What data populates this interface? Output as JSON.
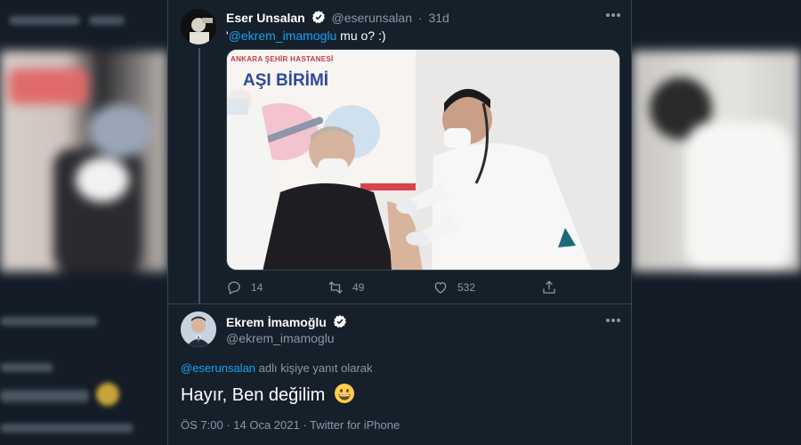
{
  "tweet1": {
    "author_name": "Eser Unsalan",
    "author_handle": "@eserunsalan",
    "separator": "·",
    "time": "31d",
    "text_prefix": "'",
    "mention": "@ekrem_imamoglu",
    "text_rest": " mu o? :)",
    "media": {
      "sign_top": "ANKARA ŞEHİR HASTANESİ",
      "sign_title": "AŞI BİRİMİ"
    },
    "actions": {
      "reply_count": "14",
      "retweet_count": "49",
      "like_count": "532"
    }
  },
  "tweet2": {
    "author_name": "Ekrem İmamoğlu",
    "author_handle": "@ekrem_imamoglu",
    "reply_to_handle": "@eserunsalan",
    "reply_to_suffix": " adlı kişiye yanıt olarak",
    "text": "Hayır, Ben değilim",
    "time": "ÖS 7:00",
    "date": "14 Oca 2021",
    "source": "Twitter for iPhone",
    "meta_separator": " · "
  },
  "colors": {
    "background": "#15202b",
    "accent": "#1da1f2",
    "secondary_text": "#8899a6",
    "border": "#38444d"
  },
  "icons": {
    "verified": "verified-badge-icon",
    "more": "more-options-icon",
    "reply": "reply-icon",
    "retweet": "retweet-icon",
    "like": "heart-icon",
    "share": "share-icon",
    "emoji": "grinning-face-emoji"
  }
}
